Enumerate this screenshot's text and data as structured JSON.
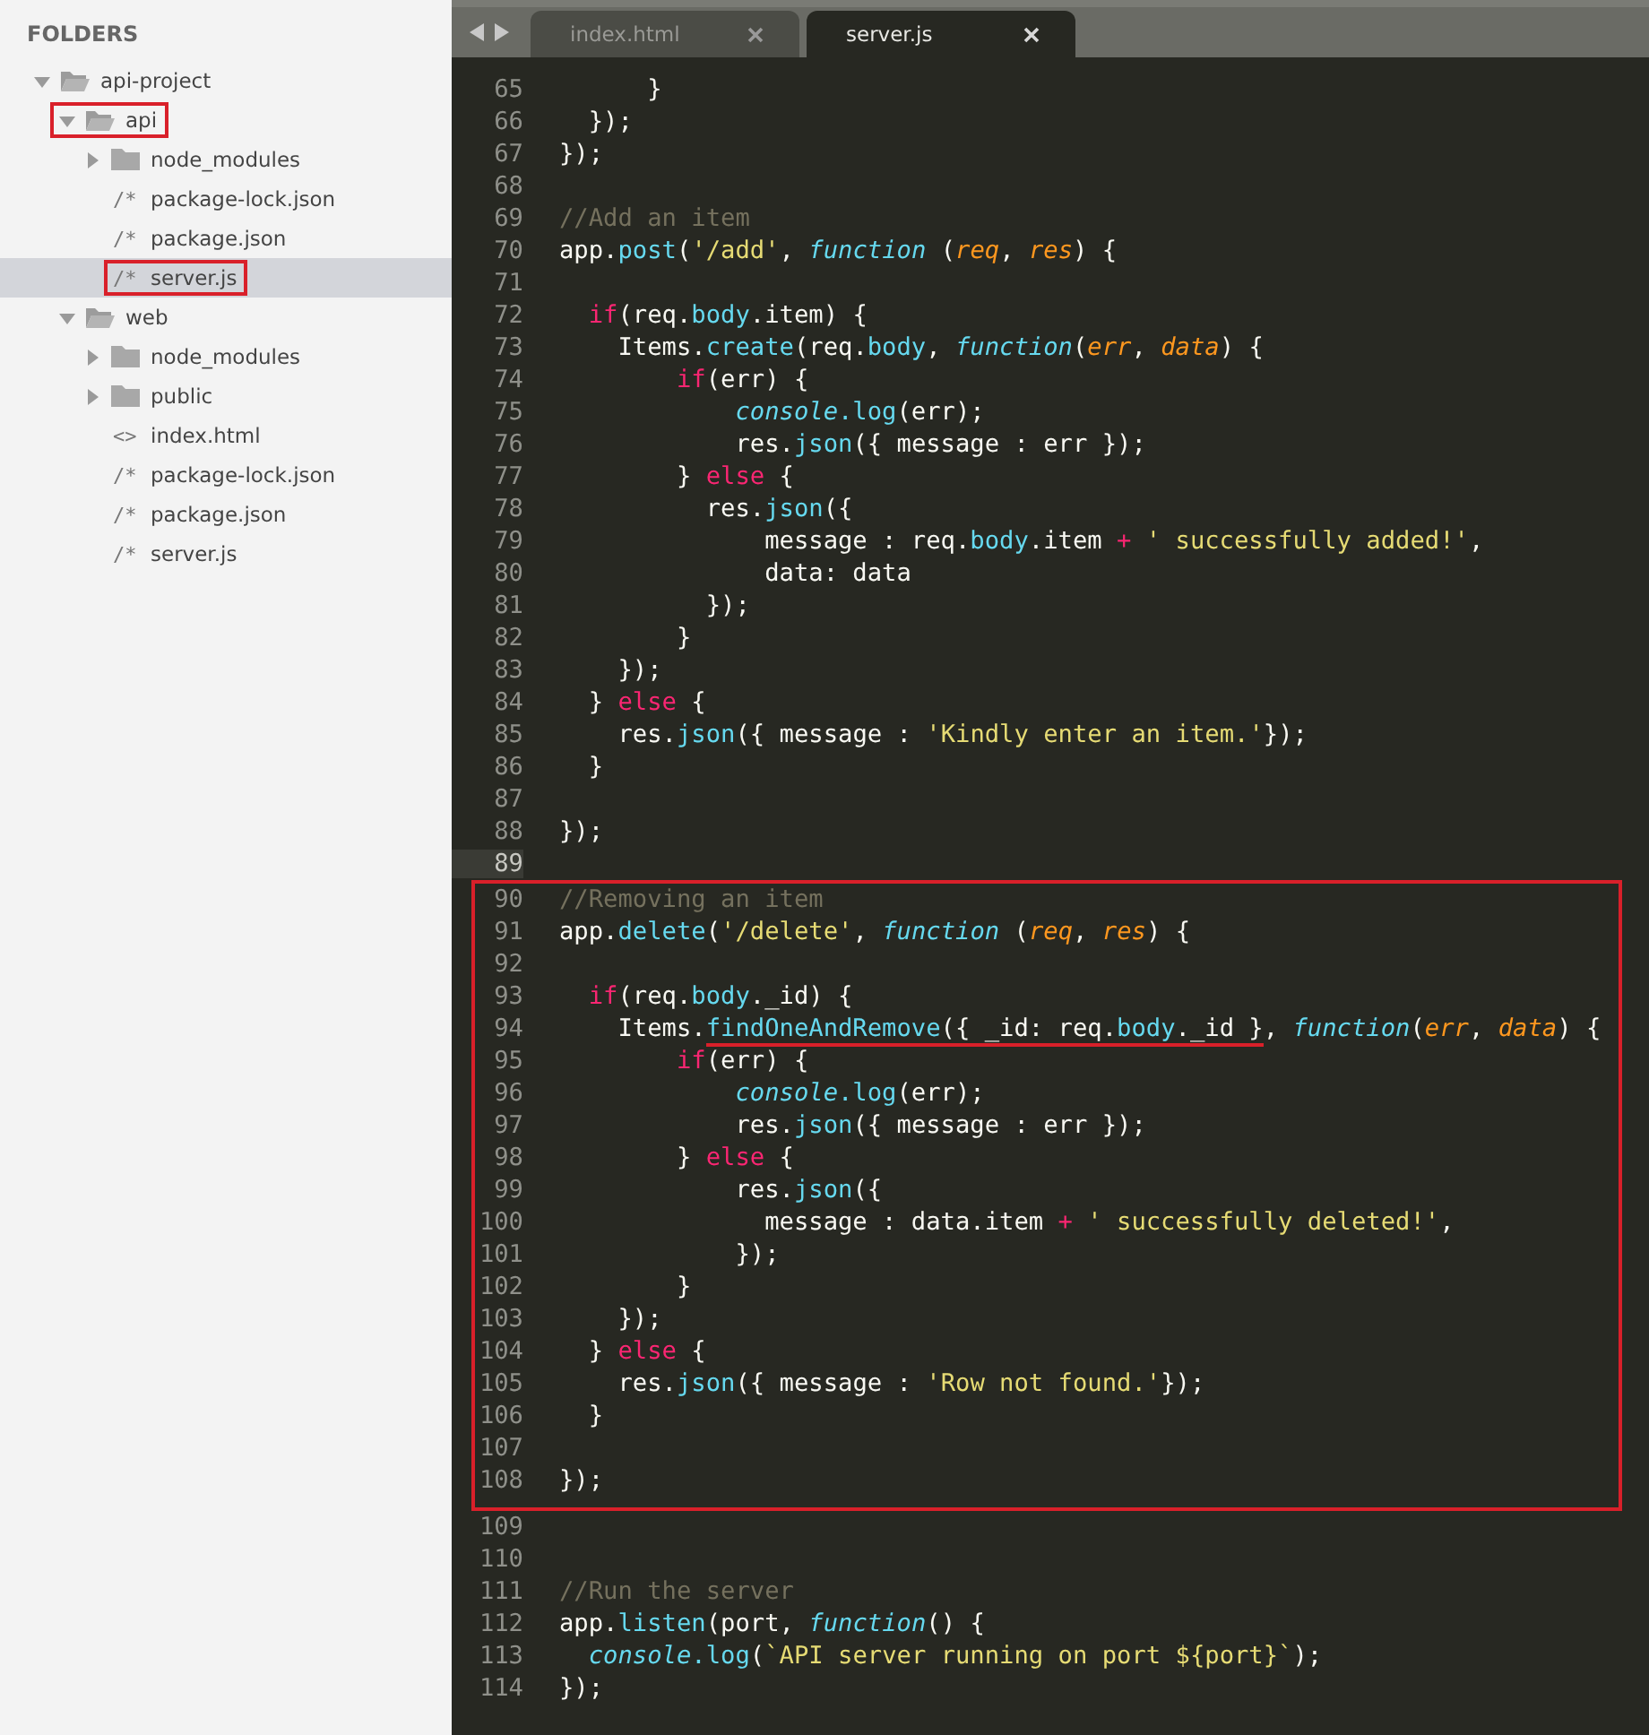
{
  "sidebar": {
    "heading": "FOLDERS",
    "tree": [
      {
        "kind": "folder",
        "name": "api-project",
        "expanded": true,
        "selected": false,
        "marked": false,
        "children": [
          {
            "kind": "folder",
            "name": "api",
            "expanded": true,
            "selected": false,
            "marked": true,
            "children": [
              {
                "kind": "folder",
                "name": "node_modules",
                "expanded": false,
                "selected": false,
                "marked": false
              },
              {
                "kind": "file",
                "glyph": "/*",
                "name": "package-lock.json",
                "selected": false,
                "marked": false
              },
              {
                "kind": "file",
                "glyph": "/*",
                "name": "package.json",
                "selected": false,
                "marked": false
              },
              {
                "kind": "file",
                "glyph": "/*",
                "name": "server.js",
                "selected": true,
                "marked": true
              }
            ]
          },
          {
            "kind": "folder",
            "name": "web",
            "expanded": true,
            "selected": false,
            "marked": false,
            "children": [
              {
                "kind": "folder",
                "name": "node_modules",
                "expanded": false,
                "selected": false,
                "marked": false
              },
              {
                "kind": "folder",
                "name": "public",
                "expanded": false,
                "selected": false,
                "marked": false
              },
              {
                "kind": "file",
                "glyph": "<>",
                "name": "index.html",
                "selected": false,
                "marked": false
              },
              {
                "kind": "file",
                "glyph": "/*",
                "name": "package-lock.json",
                "selected": false,
                "marked": false
              },
              {
                "kind": "file",
                "glyph": "/*",
                "name": "package.json",
                "selected": false,
                "marked": false
              },
              {
                "kind": "file",
                "glyph": "/*",
                "name": "server.js",
                "selected": false,
                "marked": false
              }
            ]
          }
        ]
      }
    ]
  },
  "tabs": [
    {
      "label": "index.html",
      "selected": false
    },
    {
      "label": "server.js",
      "selected": true
    }
  ],
  "editor": {
    "lines": [
      {
        "n": "65",
        "current": false,
        "boxed": false,
        "tokens": [
          {
            "kind": "text",
            "text": "      }"
          }
        ]
      },
      {
        "n": "66",
        "current": false,
        "boxed": false,
        "tokens": [
          {
            "kind": "text",
            "text": "  });"
          }
        ]
      },
      {
        "n": "67",
        "current": false,
        "boxed": false,
        "tokens": [
          {
            "kind": "text",
            "text": "});"
          }
        ]
      },
      {
        "n": "68",
        "current": false,
        "boxed": false
      },
      {
        "n": "69",
        "current": false,
        "boxed": false,
        "tokens": [
          {
            "kind": "comment",
            "text": "//Add an item"
          }
        ]
      },
      {
        "n": "70",
        "current": false,
        "boxed": false,
        "tokens": [
          {
            "kind": "text",
            "text": "app."
          },
          {
            "kind": "method",
            "text": "post"
          },
          {
            "kind": "text",
            "text": "("
          },
          {
            "kind": "string",
            "text": "'/add'"
          },
          {
            "kind": "text",
            "text": ", "
          },
          {
            "kind": "storage",
            "text": "function"
          },
          {
            "kind": "text",
            "text": " ("
          },
          {
            "kind": "param",
            "text": "req"
          },
          {
            "kind": "text",
            "text": ", "
          },
          {
            "kind": "param",
            "text": "res"
          },
          {
            "kind": "text",
            "text": ") {"
          }
        ]
      },
      {
        "n": "71",
        "current": false,
        "boxed": false
      },
      {
        "n": "72",
        "current": false,
        "boxed": false,
        "tokens": [
          {
            "kind": "keyword",
            "text": "  if"
          },
          {
            "kind": "text",
            "text": "(req."
          },
          {
            "kind": "method",
            "text": "body"
          },
          {
            "kind": "text",
            "text": ".item) {"
          }
        ]
      },
      {
        "n": "73",
        "current": false,
        "boxed": false,
        "tokens": [
          {
            "kind": "text",
            "text": "    Items."
          },
          {
            "kind": "method",
            "text": "create"
          },
          {
            "kind": "text",
            "text": "(req."
          },
          {
            "kind": "method",
            "text": "body"
          },
          {
            "kind": "text",
            "text": ", "
          },
          {
            "kind": "storage",
            "text": "function"
          },
          {
            "kind": "text",
            "text": "("
          },
          {
            "kind": "param",
            "text": "err"
          },
          {
            "kind": "text",
            "text": ", "
          },
          {
            "kind": "param",
            "text": "data"
          },
          {
            "kind": "text",
            "text": ") {"
          }
        ]
      },
      {
        "n": "74",
        "current": false,
        "boxed": false,
        "tokens": [
          {
            "kind": "keyword",
            "text": "        if"
          },
          {
            "kind": "text",
            "text": "(err) {"
          }
        ]
      },
      {
        "n": "75",
        "current": false,
        "boxed": false,
        "tokens": [
          {
            "kind": "storage",
            "text": "            console"
          },
          {
            "kind": "method",
            "text": ".log"
          },
          {
            "kind": "text",
            "text": "(err);"
          }
        ]
      },
      {
        "n": "76",
        "current": false,
        "boxed": false,
        "tokens": [
          {
            "kind": "text",
            "text": "            res."
          },
          {
            "kind": "method",
            "text": "json"
          },
          {
            "kind": "text",
            "text": "({ message : err });"
          }
        ]
      },
      {
        "n": "77",
        "current": false,
        "boxed": false,
        "tokens": [
          {
            "kind": "text",
            "text": "        } "
          },
          {
            "kind": "keyword",
            "text": "else"
          },
          {
            "kind": "text",
            "text": " {"
          }
        ]
      },
      {
        "n": "78",
        "current": false,
        "boxed": false,
        "tokens": [
          {
            "kind": "text",
            "text": "          res."
          },
          {
            "kind": "method",
            "text": "json"
          },
          {
            "kind": "text",
            "text": "({"
          }
        ]
      },
      {
        "n": "79",
        "current": false,
        "boxed": false,
        "tokens": [
          {
            "kind": "text",
            "text": "              message : req."
          },
          {
            "kind": "method",
            "text": "body"
          },
          {
            "kind": "text",
            "text": ".item "
          },
          {
            "kind": "keyword",
            "text": "+"
          },
          {
            "kind": "string",
            "text": " ' successfully added!'"
          },
          {
            "kind": "text",
            "text": ","
          }
        ]
      },
      {
        "n": "80",
        "current": false,
        "boxed": false,
        "tokens": [
          {
            "kind": "text",
            "text": "              data: data"
          }
        ]
      },
      {
        "n": "81",
        "current": false,
        "boxed": false,
        "tokens": [
          {
            "kind": "text",
            "text": "          });"
          }
        ]
      },
      {
        "n": "82",
        "current": false,
        "boxed": false,
        "tokens": [
          {
            "kind": "text",
            "text": "        }"
          }
        ]
      },
      {
        "n": "83",
        "current": false,
        "boxed": false,
        "tokens": [
          {
            "kind": "text",
            "text": "    });"
          }
        ]
      },
      {
        "n": "84",
        "current": false,
        "boxed": false,
        "tokens": [
          {
            "kind": "text",
            "text": "  } "
          },
          {
            "kind": "keyword",
            "text": "else"
          },
          {
            "kind": "text",
            "text": " {"
          }
        ]
      },
      {
        "n": "85",
        "current": false,
        "boxed": false,
        "tokens": [
          {
            "kind": "text",
            "text": "    res."
          },
          {
            "kind": "method",
            "text": "json"
          },
          {
            "kind": "text",
            "text": "({ message : "
          },
          {
            "kind": "string",
            "text": "'Kindly enter an item.'"
          },
          {
            "kind": "text",
            "text": "});"
          }
        ]
      },
      {
        "n": "86",
        "current": false,
        "boxed": false,
        "tokens": [
          {
            "kind": "text",
            "text": "  }"
          }
        ]
      },
      {
        "n": "87",
        "current": false,
        "boxed": false
      },
      {
        "n": "88",
        "current": false,
        "boxed": false,
        "tokens": [
          {
            "kind": "text",
            "text": "});"
          }
        ]
      },
      {
        "n": "89",
        "current": true,
        "boxed": false
      },
      {
        "n": "90",
        "current": false,
        "boxed": true,
        "tokens": [
          {
            "kind": "comment",
            "text": "//Removing an item"
          }
        ]
      },
      {
        "n": "91",
        "current": false,
        "boxed": true,
        "tokens": [
          {
            "kind": "text",
            "text": "app."
          },
          {
            "kind": "method",
            "text": "delete"
          },
          {
            "kind": "text",
            "text": "("
          },
          {
            "kind": "string",
            "text": "'/delete'"
          },
          {
            "kind": "text",
            "text": ", "
          },
          {
            "kind": "storage",
            "text": "function"
          },
          {
            "kind": "text",
            "text": " ("
          },
          {
            "kind": "param",
            "text": "req"
          },
          {
            "kind": "text",
            "text": ", "
          },
          {
            "kind": "param",
            "text": "res"
          },
          {
            "kind": "text",
            "text": ") {"
          }
        ]
      },
      {
        "n": "92",
        "current": false,
        "boxed": true
      },
      {
        "n": "93",
        "current": false,
        "boxed": true,
        "tokens": [
          {
            "kind": "keyword",
            "text": "  if"
          },
          {
            "kind": "text",
            "text": "(req."
          },
          {
            "kind": "method",
            "text": "body"
          },
          {
            "kind": "text",
            "text": "._id) {"
          }
        ]
      },
      {
        "n": "94",
        "current": false,
        "boxed": true,
        "tokens": [
          {
            "kind": "text",
            "text": "    Items."
          },
          {
            "kind": "method",
            "text": "findOneAndRemove",
            "underlined": true
          },
          {
            "kind": "text",
            "text": "({ _id: req.",
            "underlined": true
          },
          {
            "kind": "method",
            "text": "body",
            "underlined": true
          },
          {
            "kind": "text",
            "text": "._id }",
            "underlined": true
          },
          {
            "kind": "text",
            "text": ", "
          },
          {
            "kind": "storage",
            "text": "function"
          },
          {
            "kind": "text",
            "text": "("
          },
          {
            "kind": "param",
            "text": "err"
          },
          {
            "kind": "text",
            "text": ", "
          },
          {
            "kind": "param",
            "text": "data"
          },
          {
            "kind": "text",
            "text": ") {"
          }
        ]
      },
      {
        "n": "95",
        "current": false,
        "boxed": true,
        "tokens": [
          {
            "kind": "keyword",
            "text": "        if"
          },
          {
            "kind": "text",
            "text": "(err) {"
          }
        ]
      },
      {
        "n": "96",
        "current": false,
        "boxed": true,
        "tokens": [
          {
            "kind": "storage",
            "text": "            console"
          },
          {
            "kind": "method",
            "text": ".log"
          },
          {
            "kind": "text",
            "text": "(err);"
          }
        ]
      },
      {
        "n": "97",
        "current": false,
        "boxed": true,
        "tokens": [
          {
            "kind": "text",
            "text": "            res."
          },
          {
            "kind": "method",
            "text": "json"
          },
          {
            "kind": "text",
            "text": "({ message : err });"
          }
        ]
      },
      {
        "n": "98",
        "current": false,
        "boxed": true,
        "tokens": [
          {
            "kind": "text",
            "text": "        } "
          },
          {
            "kind": "keyword",
            "text": "else"
          },
          {
            "kind": "text",
            "text": " {"
          }
        ]
      },
      {
        "n": "99",
        "current": false,
        "boxed": true,
        "tokens": [
          {
            "kind": "text",
            "text": "            res."
          },
          {
            "kind": "method",
            "text": "json"
          },
          {
            "kind": "text",
            "text": "({"
          }
        ]
      },
      {
        "n": "100",
        "current": false,
        "boxed": true,
        "tokens": [
          {
            "kind": "text",
            "text": "              message : data.item "
          },
          {
            "kind": "keyword",
            "text": "+"
          },
          {
            "kind": "string",
            "text": " ' successfully deleted!'"
          },
          {
            "kind": "text",
            "text": ","
          }
        ]
      },
      {
        "n": "101",
        "current": false,
        "boxed": true,
        "tokens": [
          {
            "kind": "text",
            "text": "            });"
          }
        ]
      },
      {
        "n": "102",
        "current": false,
        "boxed": true,
        "tokens": [
          {
            "kind": "text",
            "text": "        }"
          }
        ]
      },
      {
        "n": "103",
        "current": false,
        "boxed": true,
        "tokens": [
          {
            "kind": "text",
            "text": "    });"
          }
        ]
      },
      {
        "n": "104",
        "current": false,
        "boxed": true,
        "tokens": [
          {
            "kind": "text",
            "text": "  } "
          },
          {
            "kind": "keyword",
            "text": "else"
          },
          {
            "kind": "text",
            "text": " {"
          }
        ]
      },
      {
        "n": "105",
        "current": false,
        "boxed": true,
        "tokens": [
          {
            "kind": "text",
            "text": "    res."
          },
          {
            "kind": "method",
            "text": "json"
          },
          {
            "kind": "text",
            "text": "({ message : "
          },
          {
            "kind": "string",
            "text": "'Row not found.'"
          },
          {
            "kind": "text",
            "text": "});"
          }
        ]
      },
      {
        "n": "106",
        "current": false,
        "boxed": true,
        "tokens": [
          {
            "kind": "text",
            "text": "  }"
          }
        ]
      },
      {
        "n": "107",
        "current": false,
        "boxed": true
      },
      {
        "n": "108",
        "current": false,
        "boxed": true,
        "tokens": [
          {
            "kind": "text",
            "text": "});"
          }
        ]
      },
      {
        "n": "109",
        "current": false,
        "boxed": false
      },
      {
        "n": "110",
        "current": false,
        "boxed": false
      },
      {
        "n": "111",
        "current": false,
        "boxed": false,
        "tokens": [
          {
            "kind": "comment",
            "text": "//Run the server"
          }
        ]
      },
      {
        "n": "112",
        "current": false,
        "boxed": false,
        "tokens": [
          {
            "kind": "text",
            "text": "app."
          },
          {
            "kind": "method",
            "text": "listen"
          },
          {
            "kind": "text",
            "text": "(port, "
          },
          {
            "kind": "storage",
            "text": "function"
          },
          {
            "kind": "text",
            "text": "() {"
          }
        ]
      },
      {
        "n": "113",
        "current": false,
        "boxed": false,
        "tokens": [
          {
            "kind": "storage",
            "text": "  console"
          },
          {
            "kind": "method",
            "text": ".log"
          },
          {
            "kind": "text",
            "text": "("
          },
          {
            "kind": "string",
            "text": "`API server running on port ${port}`"
          },
          {
            "kind": "text",
            "text": ");"
          }
        ]
      },
      {
        "n": "114",
        "current": false,
        "boxed": false,
        "tokens": [
          {
            "kind": "text",
            "text": "});"
          }
        ]
      }
    ]
  }
}
